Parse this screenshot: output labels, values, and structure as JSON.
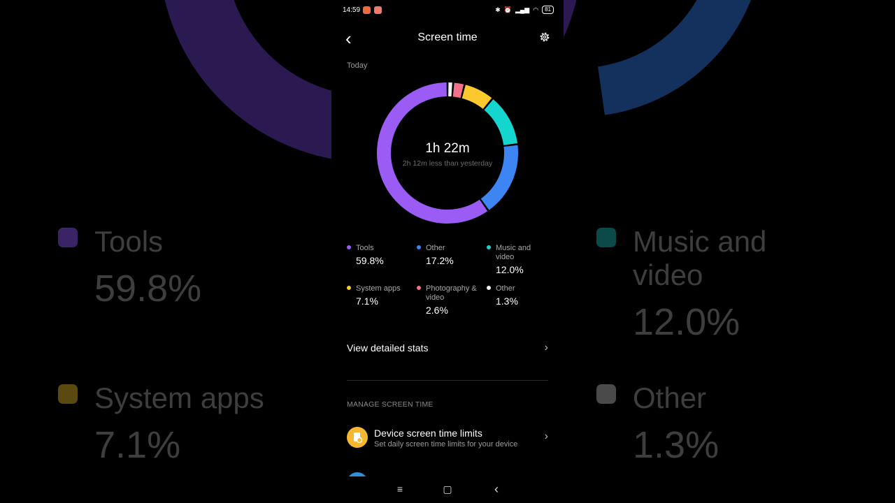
{
  "status_bar": {
    "time": "14:59",
    "battery": "81"
  },
  "header": {
    "title": "Screen time"
  },
  "period_label": "Today",
  "summary": {
    "total": "1h 22m",
    "comparison": "2h 12m less than yesterday"
  },
  "categories": [
    {
      "name": "Tools",
      "pct": "59.8%",
      "value": 59.8,
      "color": "#9b5cf6"
    },
    {
      "name": "Other",
      "pct": "17.2%",
      "value": 17.2,
      "color": "#3d85f2"
    },
    {
      "name": "Music and video",
      "pct": "12.0%",
      "value": 12.0,
      "color": "#14d6cf"
    },
    {
      "name": "System apps",
      "pct": "7.1%",
      "value": 7.1,
      "color": "#fbc82d"
    },
    {
      "name": "Photography & video",
      "pct": "2.6%",
      "value": 2.6,
      "color": "#f2708a"
    },
    {
      "name": "Other",
      "pct": "1.3%",
      "value": 1.3,
      "color": "#f2f2f2"
    }
  ],
  "links": {
    "detailed_stats": "View detailed stats"
  },
  "manage": {
    "section_title": "MANAGE SCREEN TIME",
    "device_limits_title": "Device screen time limits",
    "device_limits_sub": "Set daily screen time limits for your device"
  },
  "background": {
    "items": [
      {
        "name": "Tools",
        "pct": "59.8%",
        "color": "#3a2466"
      },
      {
        "name": "Music and video",
        "pct": "12.0%",
        "color": "#0b4a48"
      },
      {
        "name": "System apps",
        "pct": "7.1%",
        "color": "#5a4a10"
      },
      {
        "name": "Other",
        "pct": "1.3%",
        "color": "#4a4a4a"
      }
    ]
  }
}
